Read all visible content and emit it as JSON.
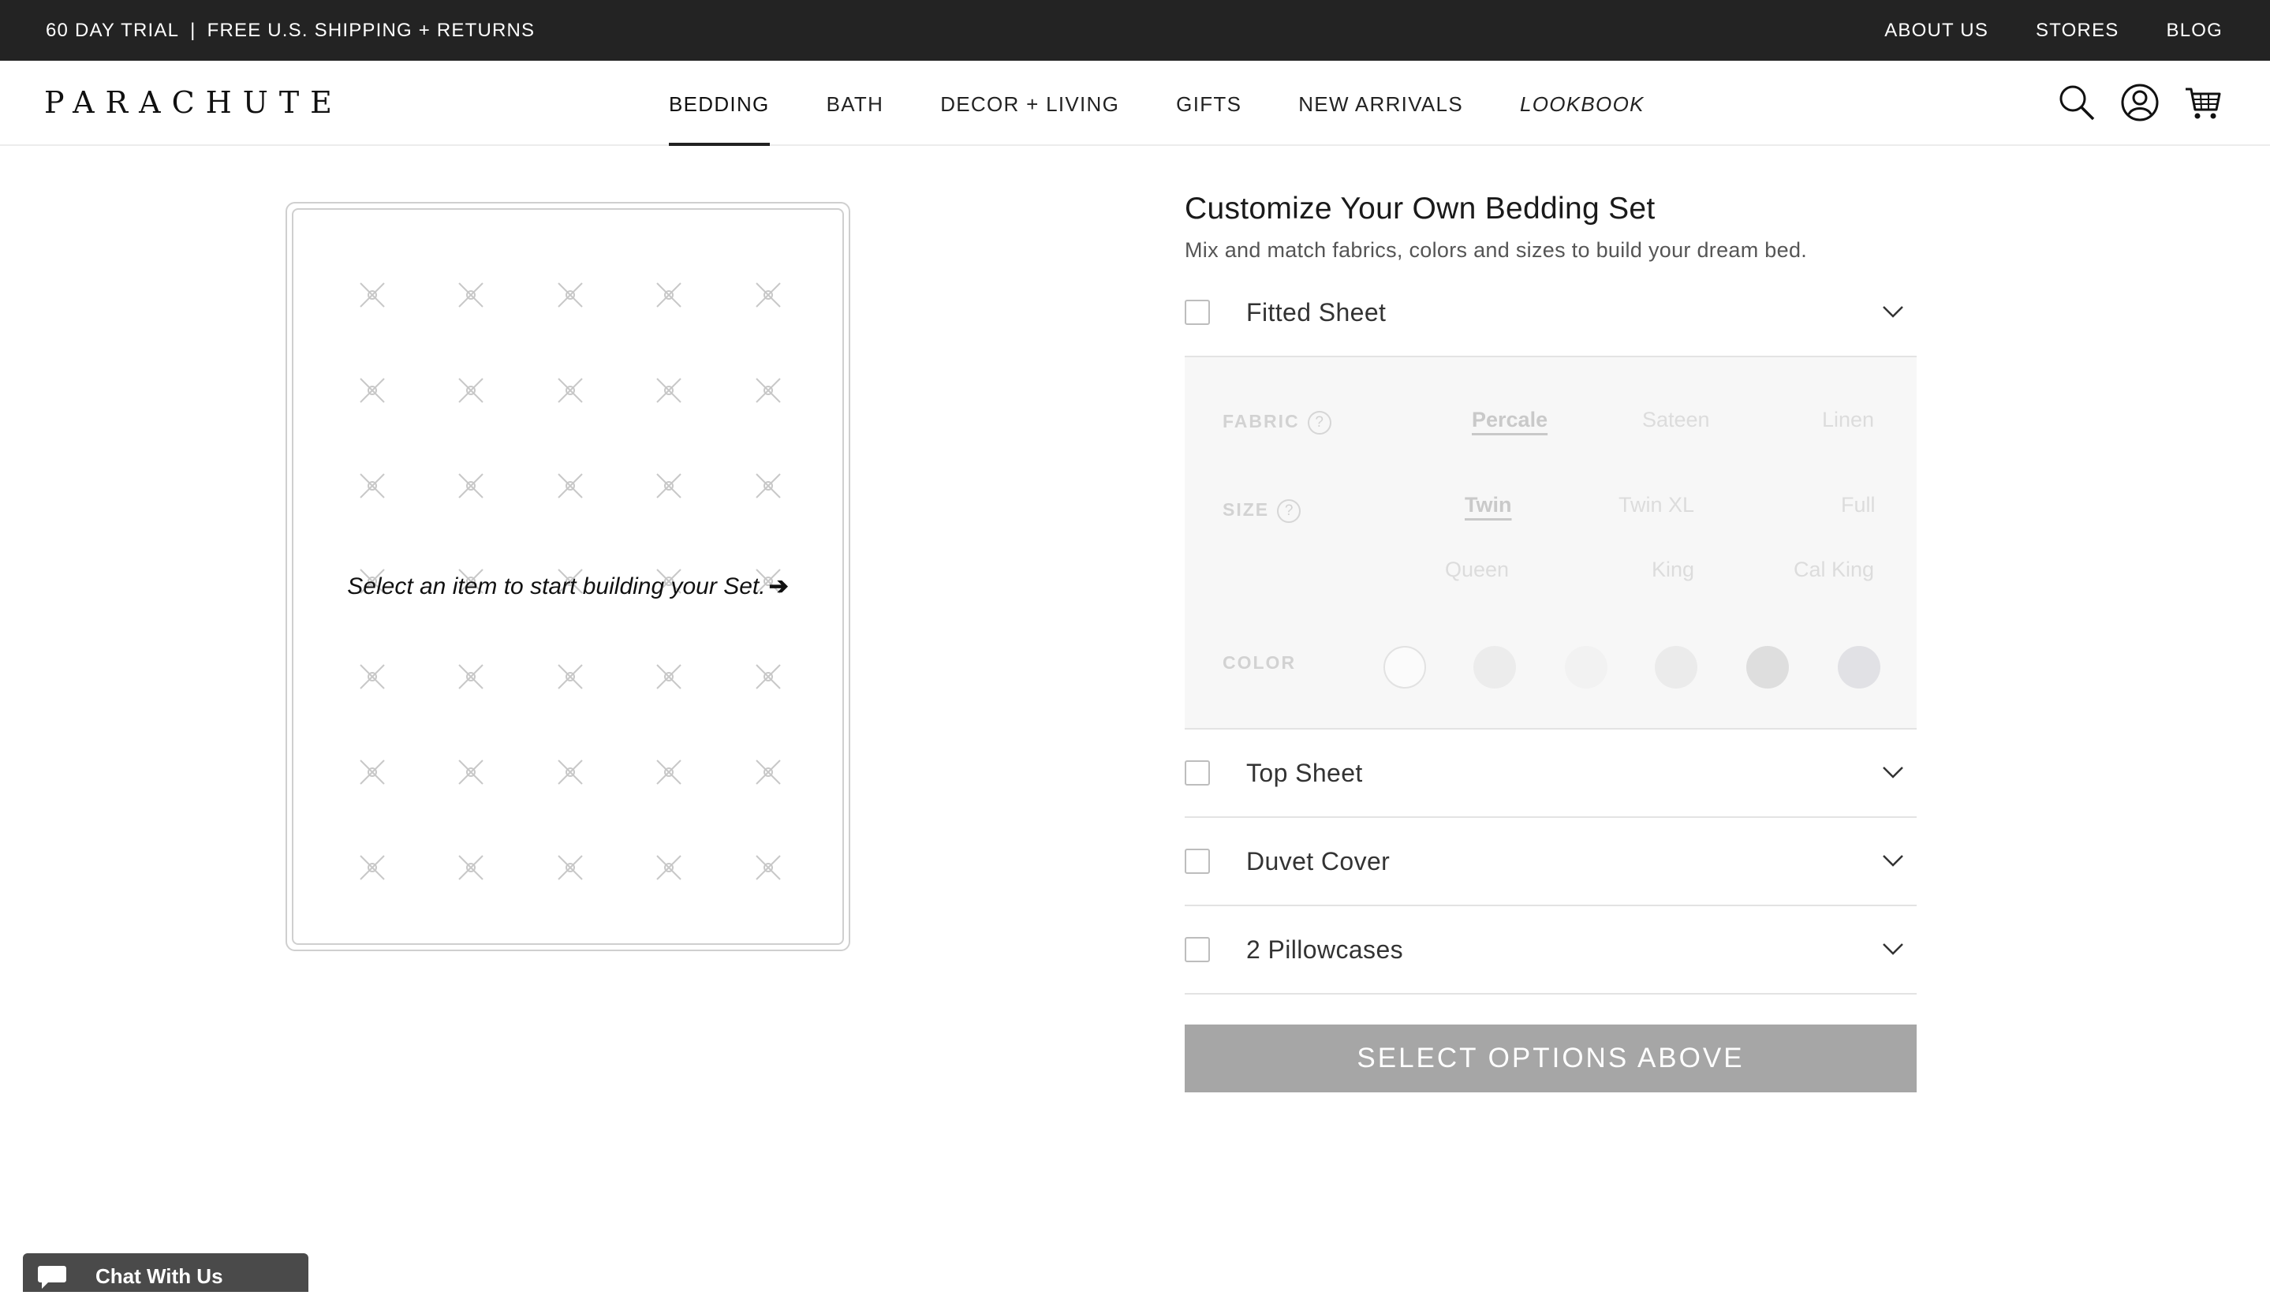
{
  "topbar": {
    "trial": "60 DAY TRIAL",
    "separator": "|",
    "shipping": "FREE U.S. SHIPPING + RETURNS",
    "links": [
      "ABOUT US",
      "STORES",
      "BLOG"
    ]
  },
  "header": {
    "logo": "PARACHUTE",
    "nav": [
      "BEDDING",
      "BATH",
      "DECOR + LIVING",
      "GIFTS",
      "NEW ARRIVALS",
      "LOOKBOOK"
    ],
    "active_nav": "BEDDING",
    "icons": [
      "search-icon",
      "account-icon",
      "cart-icon"
    ]
  },
  "preview": {
    "message": "Select an item to start building your Set.",
    "arrow": "➔"
  },
  "customize": {
    "title": "Customize Your Own Bedding Set",
    "subtitle": "Mix and match fabrics, colors and sizes to build your dream bed.",
    "items": [
      {
        "label": "Fitted Sheet",
        "checked": false,
        "expanded": true
      },
      {
        "label": "Top Sheet",
        "checked": false,
        "expanded": false
      },
      {
        "label": "Duvet Cover",
        "checked": false,
        "expanded": false
      },
      {
        "label": "2 Pillowcases",
        "checked": false,
        "expanded": false
      }
    ],
    "options": {
      "fabric_label": "FABRIC",
      "fabrics": [
        "Percale",
        "Sateen",
        "Linen"
      ],
      "selected_fabric": "Percale",
      "size_label": "SIZE",
      "sizes": [
        "Twin",
        "Twin XL",
        "Full",
        "Queen",
        "King",
        "Cal King"
      ],
      "selected_size": "Twin",
      "color_label": "COLOR",
      "help_glyph": "?",
      "colors": [
        "#fbfbfb",
        "#ececec",
        "#f2f2f2",
        "#ebebeb",
        "#dedede",
        "#e1e1e5"
      ]
    },
    "cta": "SELECT OPTIONS ABOVE"
  },
  "chat": {
    "label": "Chat With Us"
  }
}
